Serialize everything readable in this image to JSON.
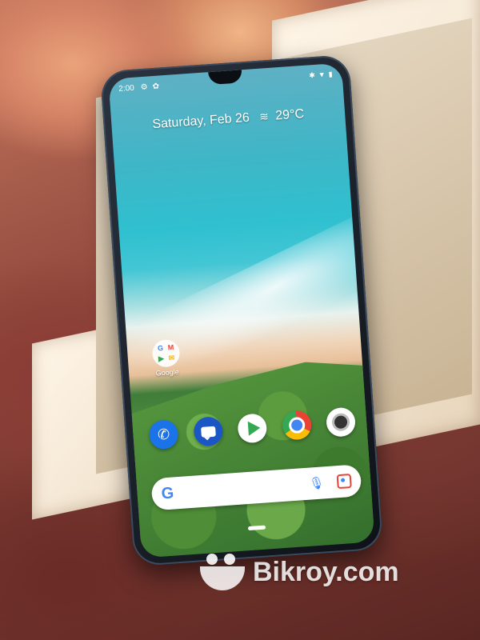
{
  "status_bar": {
    "time": "2:00",
    "icons_left": [
      "gear-icon",
      "pinwheel-icon"
    ],
    "icons_right": [
      "bluetooth-icon",
      "wifi-icon",
      "battery-icon"
    ]
  },
  "glance": {
    "date": "Saturday, Feb 26",
    "weather_icon": "haze-icon",
    "temperature": "29°C"
  },
  "folder": {
    "label": "Google",
    "apps": [
      "G",
      "M",
      "▶",
      "✉"
    ]
  },
  "dock_apps": [
    {
      "name": "Phone",
      "icon": "phone-icon"
    },
    {
      "name": "Messages",
      "icon": "messages-icon"
    },
    {
      "name": "Play Store",
      "icon": "play-store-icon"
    },
    {
      "name": "Chrome",
      "icon": "chrome-icon"
    },
    {
      "name": "Camera",
      "icon": "camera-icon"
    }
  ],
  "search_bar": {
    "logo": "G",
    "mic_icon": "mic-icon",
    "lens_icon": "lens-icon"
  },
  "watermark": {
    "text": "Bikroy.com"
  },
  "colors": {
    "google_blue": "#4285f4",
    "google_red": "#ea4335",
    "google_yellow": "#fbbc05",
    "google_green": "#34a853"
  }
}
